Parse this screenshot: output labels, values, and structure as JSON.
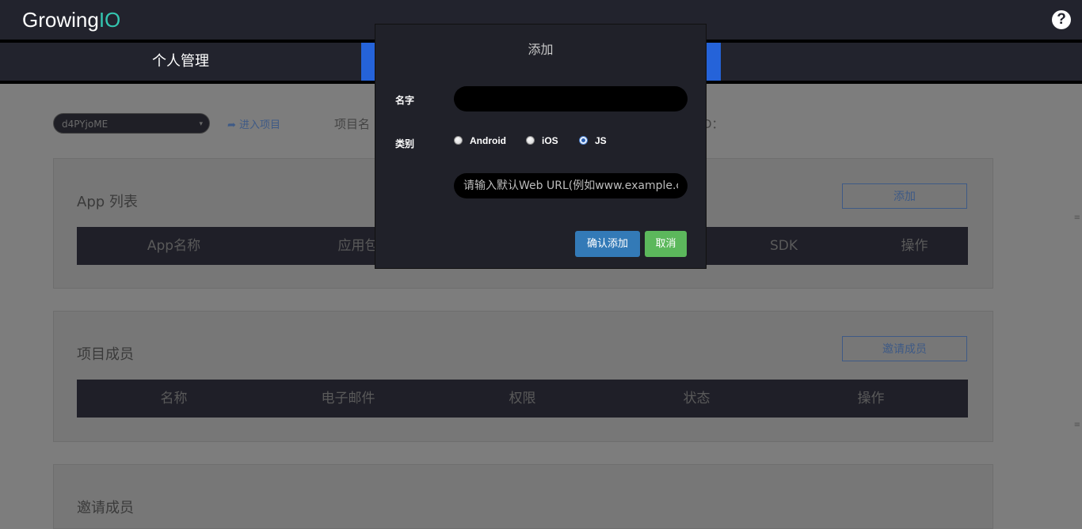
{
  "header": {
    "logo_main": "Growing",
    "logo_accent": "IO",
    "help_icon": "question-circle-icon"
  },
  "nav": {
    "tabs": [
      {
        "label": "个人管理",
        "active": false
      },
      {
        "label": "",
        "active": true
      }
    ]
  },
  "toolbar": {
    "project_select_value": "d4PYjoME",
    "enter_project_label": "进入项目",
    "project_name_label": "项目名",
    "project_id_label": "D："
  },
  "app_list": {
    "title": "App 列表",
    "add_button": "添加",
    "columns": [
      "App名称",
      "应用包",
      "",
      "",
      "SDK",
      "操作"
    ]
  },
  "members": {
    "title": "项目成员",
    "invite_button": "邀请成员",
    "columns": [
      "名称",
      "电子邮件",
      "权限",
      "状态",
      "操作"
    ]
  },
  "invites": {
    "title": "邀请成员"
  },
  "modal": {
    "title": "添加",
    "name_label": "名字",
    "name_value": "",
    "type_label": "类别",
    "type_options": [
      "Android",
      "iOS",
      "JS"
    ],
    "type_selected": "JS",
    "url_placeholder": "请输入默认Web URL(例如www.example.com)",
    "confirm_label": "确认添加",
    "cancel_label": "取消"
  },
  "colors": {
    "header_bg": "#22232d",
    "active_tab": "#2563d9",
    "logo_accent": "#34c6b0",
    "confirm": "#337ab7",
    "cancel": "#5cb85c"
  }
}
